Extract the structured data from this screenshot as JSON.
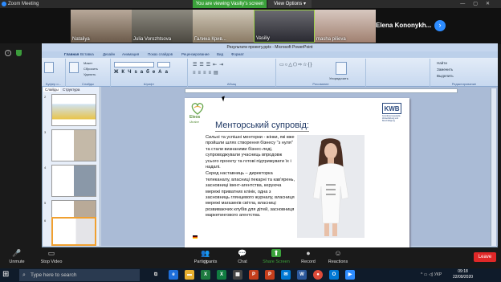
{
  "zoom": {
    "title": "Zoom Meeting",
    "viewing": "You are viewing Vasiliy's screen",
    "view_options": "View Options ▾"
  },
  "participants": [
    {
      "name": "Nataliya"
    },
    {
      "name": "Julia Vorozhtsova"
    },
    {
      "name": "Галина Крив..."
    },
    {
      "name": "Vasiliy"
    },
    {
      "name": "masha pilieva"
    }
  ],
  "active_speaker": "Elena Kononykh...",
  "ppt": {
    "title": "Результати проекту.pptx - Microsoft PowerPoint",
    "tabs": [
      "Главная",
      "Вставка",
      "Дизайн",
      "Анимация",
      "Показ слайдов",
      "Рецензирование",
      "Вид",
      "Формат"
    ],
    "groups": [
      "Буфер о...",
      "Слайды",
      "Шрифт",
      "Абзац",
      "Рисование",
      "Редактирование"
    ],
    "side_tabs": [
      "Слайды",
      "Структура"
    ],
    "paste": "Вставить",
    "layout": "Макет",
    "reset": "Сбросить",
    "create": "Создать слайд",
    "delete": "Удалить",
    "arrange": "Упорядочить",
    "find": "Найти",
    "replace": "Заменить",
    "select": "Выделить"
  },
  "thumbs": [
    {
      "n": "2"
    },
    {
      "n": "3"
    },
    {
      "n": "4"
    },
    {
      "n": "5"
    },
    {
      "n": "6"
    }
  ],
  "slide": {
    "eleos": "Eleos",
    "eleos_sub": "Ukraine",
    "kwb": "KWB",
    "kwb_sub": "Koordinierungsstelle Weiterbildung und Beschäftigung",
    "title": "Менторський супровід:",
    "p1": "Сильні та успішні менторки - жінки, які вже пройшли шлях створення бізнесу \"з нуля\" та стали визнаними бізнес-леді, супроводжували учасниць впродовж усього проекту та готові підтримувати їх і надалі.",
    "p2": "Серед наставниць – директорка телеканалу, власниці пекарні та кав'ярень, засновниці івент-агентства, керуюча мережі приватних клінік, одна з засновниць глянцевого журналу, власниця мережі магазинів світла, власниці розвиваючих клубів для дітей, засновниця маркетингового агентства."
  },
  "toolbar": [
    {
      "label": "Unmute",
      "icon": "🎤"
    },
    {
      "label": "Stop Video",
      "icon": "▭"
    },
    {
      "label": "Participants",
      "icon": "👥",
      "count": "15"
    },
    {
      "label": "Chat",
      "icon": "💬"
    },
    {
      "label": "Share Screen",
      "icon": "⬆"
    },
    {
      "label": "Record",
      "icon": "●"
    },
    {
      "label": "Reactions",
      "icon": "☺"
    }
  ],
  "leave": "Leave",
  "taskbar": {
    "search": "Type here to search",
    "time": "09:18",
    "date": "22/09/2020",
    "lang": "УКР"
  },
  "colors": {
    "share_green": "#3ba23b",
    "leave_red": "#e02828",
    "zoom_blue": "#2d8cff"
  }
}
